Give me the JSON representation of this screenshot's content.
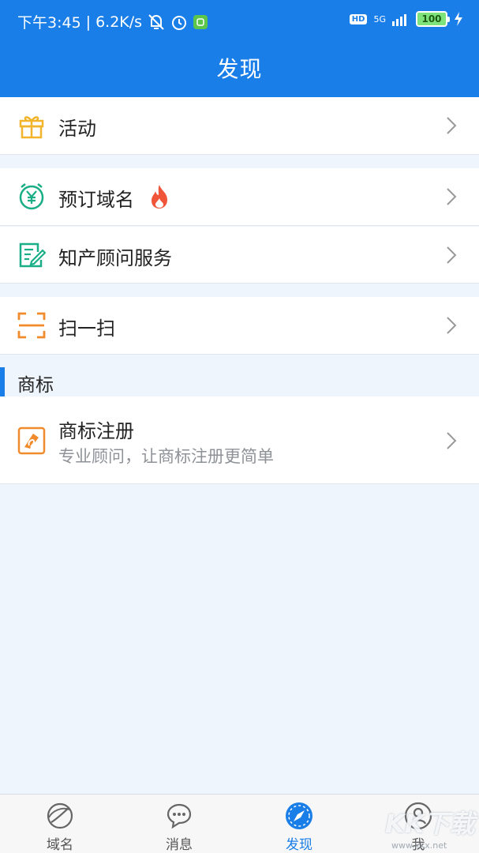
{
  "status_bar": {
    "time": "下午3:45",
    "separator": "|",
    "speed": "6.2K/s",
    "hd": "HD",
    "network": "5G",
    "battery": "100"
  },
  "header": {
    "title": "发现"
  },
  "rows": {
    "activity": {
      "label": "活动",
      "icon": "gift-icon"
    },
    "reserve_domain": {
      "label": "预订域名",
      "icon": "yuan-clock-icon",
      "badge_icon": "fire-icon"
    },
    "ip_consult": {
      "label": "知产顾问服务",
      "icon": "document-edit-icon"
    },
    "scan": {
      "label": "扫一扫",
      "icon": "scan-icon"
    }
  },
  "trademark_section": {
    "title": "商标",
    "item": {
      "label": "商标注册",
      "subtitle": "专业顾问，让商标注册更简单",
      "icon": "trademark-icon"
    }
  },
  "tabs": [
    {
      "label": "域名",
      "icon": "globe-icon",
      "active": false
    },
    {
      "label": "消息",
      "icon": "chat-icon",
      "active": false
    },
    {
      "label": "发现",
      "icon": "compass-icon",
      "active": true
    },
    {
      "label": "我",
      "icon": "user-icon",
      "active": false
    }
  ],
  "watermark": {
    "text": "KK下载",
    "url": "www.kkx.net"
  },
  "colors": {
    "primary": "#1a7ee8",
    "background": "#eef5fc",
    "gift": "#f2b42a",
    "green": "#1aae87",
    "orange": "#f08a2a",
    "fire": "#f0553a"
  }
}
